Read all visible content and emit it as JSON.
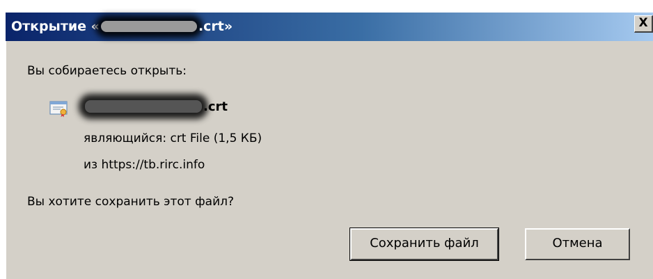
{
  "dialog": {
    "title_prefix": "Открытие «",
    "title_suffix": ".crt»",
    "close_label": "X",
    "question_open": "Вы собираетесь открыть:",
    "file": {
      "name_suffix": ".crt",
      "type_label": "являющийся:",
      "type_value": "crt File (1,5 КБ)",
      "from_label": "из",
      "from_value": "https://tb.rirc.info"
    },
    "question_save": "Вы хотите сохранить этот файл?",
    "buttons": {
      "save": "Сохранить файл",
      "cancel": "Отмена"
    }
  },
  "colors": {
    "titlebar_start": "#0a246a",
    "titlebar_end": "#a6caf0",
    "window_face": "#d4d0c8"
  },
  "icons": {
    "file": "certificate-file-icon",
    "close": "close-icon"
  }
}
